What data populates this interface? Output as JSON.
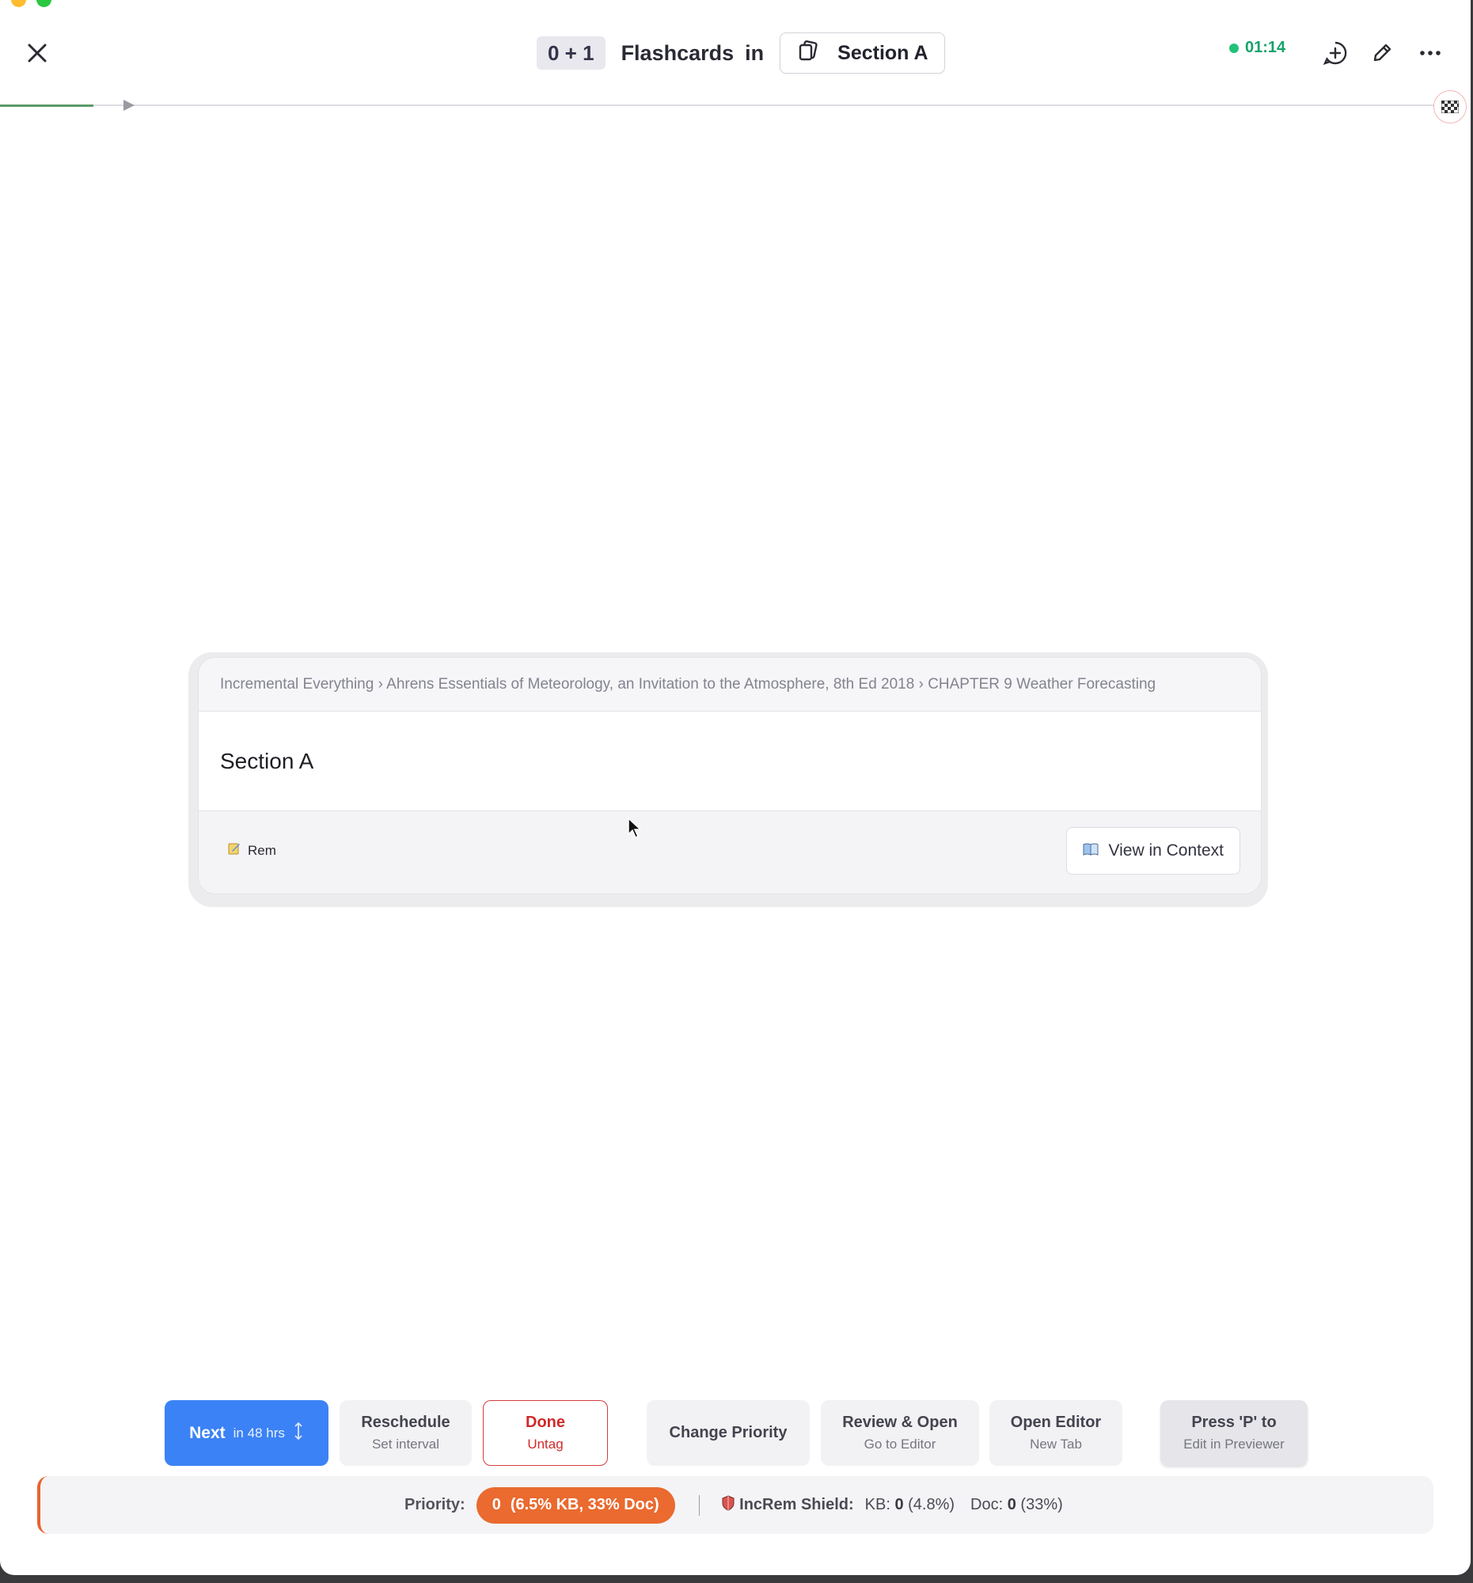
{
  "header": {
    "count": "0 + 1",
    "title": "Flashcards",
    "in_label": "in",
    "section": "Section A",
    "timer": "01:14"
  },
  "progress": {
    "fraction": 0.065
  },
  "card": {
    "breadcrumb": "Incremental Everything › Ahrens Essentials of Meteorology, an Invitation to the Atmosphere, 8th Ed 2018 › CHAPTER 9 Weather Forecasting",
    "title": "Section A",
    "rem_label": "Rem",
    "view_context_label": "View in Context"
  },
  "actions": {
    "next": {
      "label": "Next",
      "sub": "in 48 hrs"
    },
    "reschedule": {
      "label": "Reschedule",
      "sub": "Set interval"
    },
    "done": {
      "label": "Done",
      "sub": "Untag"
    },
    "change_priority": {
      "label": "Change Priority"
    },
    "review_open": {
      "label": "Review & Open",
      "sub": "Go to Editor"
    },
    "open_editor": {
      "label": "Open Editor",
      "sub": "New Tab"
    },
    "press_p": {
      "label": "Press 'P' to",
      "sub": "Edit in Previewer"
    }
  },
  "status": {
    "priority_label": "Priority:",
    "priority_value": "0",
    "priority_detail": "(6.5% KB, 33% Doc)",
    "shield_label": "IncRem Shield:",
    "kb_label": "KB:",
    "kb_value": "0",
    "kb_pct": "(4.8%)",
    "doc_label": "Doc:",
    "doc_value": "0",
    "doc_pct": "(33%)"
  },
  "colors": {
    "accent_blue": "#3b82f6",
    "priority_orange": "#ea6a2f",
    "done_red": "#d12a2a",
    "timer_green": "#16a36b"
  },
  "icons": [
    "close-icon",
    "flashcards-icon",
    "add-icon",
    "pencil-icon",
    "more-icon",
    "finish-flag-icon",
    "rem-icon",
    "book-icon",
    "updown-arrows-icon",
    "shield-icon",
    "cursor-icon"
  ]
}
